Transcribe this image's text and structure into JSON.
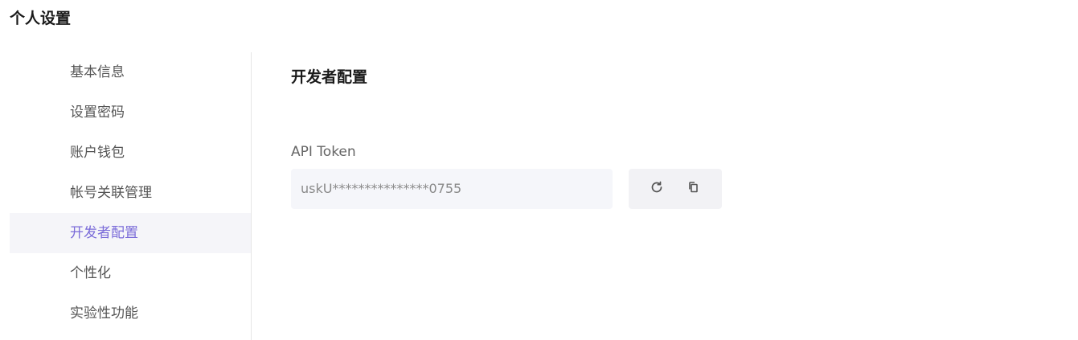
{
  "page": {
    "title": "个人设置"
  },
  "sidebar": {
    "items": [
      {
        "label": "基本信息",
        "active": false
      },
      {
        "label": "设置密码",
        "active": false
      },
      {
        "label": "账户钱包",
        "active": false
      },
      {
        "label": "帐号关联管理",
        "active": false
      },
      {
        "label": "开发者配置",
        "active": true
      },
      {
        "label": "个性化",
        "active": false
      },
      {
        "label": "实验性功能",
        "active": false
      }
    ],
    "active_color": "#7b6cd9"
  },
  "main": {
    "section_title": "开发者配置",
    "api_token": {
      "label": "API Token",
      "value": "uskU***************0755"
    },
    "actions": {
      "refresh_icon": "refresh-icon",
      "copy_icon": "copy-icon"
    }
  }
}
